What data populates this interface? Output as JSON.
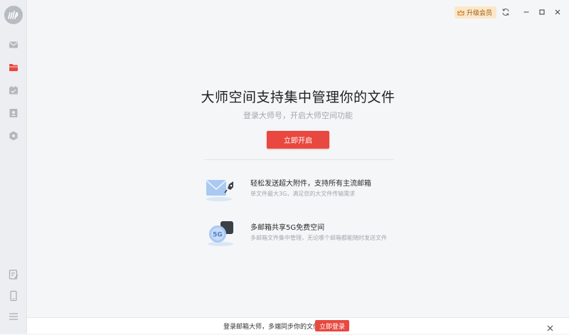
{
  "sidebar": {
    "logo_text": "dmp",
    "items": [
      {
        "name": "mail",
        "icon": "mail-icon"
      },
      {
        "name": "file-manager",
        "icon": "folder-icon",
        "active": true
      },
      {
        "name": "calendar",
        "icon": "calendar-check-icon"
      },
      {
        "name": "contacts",
        "icon": "contact-icon"
      },
      {
        "name": "apps",
        "icon": "hexagon-icon"
      }
    ],
    "bottom_items": [
      {
        "name": "notes",
        "icon": "edit-note-icon"
      },
      {
        "name": "mobile",
        "icon": "phone-icon"
      },
      {
        "name": "menu",
        "icon": "menu-icon"
      }
    ]
  },
  "topbar": {
    "upgrade_label": "升级会员",
    "upgrade_icon": "crown-icon"
  },
  "main": {
    "title": "大师空间支持集中管理你的文件",
    "subtitle": "登录大师号，开启大师空间功能",
    "primary_button": "立即开启",
    "features": [
      {
        "title": "轻松发送超大附件，支持所有主流邮箱",
        "desc": "单文件最大3G，满足您的大文件传输需求",
        "icon": "mail-rocket-icon"
      },
      {
        "title": "多邮箱共享5G免费空间",
        "desc": "多邮箱文件集中管理，无论哪个邮箱都能随时发送文件",
        "icon": "cloud-5g-icon",
        "badge": "5G"
      }
    ]
  },
  "bottombar": {
    "text": "登录邮箱大师，多端同步你的文件",
    "button": "立即登录"
  },
  "colors": {
    "accent": "#e8483f",
    "upgrade_bg": "#fbe7c9",
    "sidebar_bg": "#eceef1",
    "main_bg": "#f5f6f8"
  }
}
